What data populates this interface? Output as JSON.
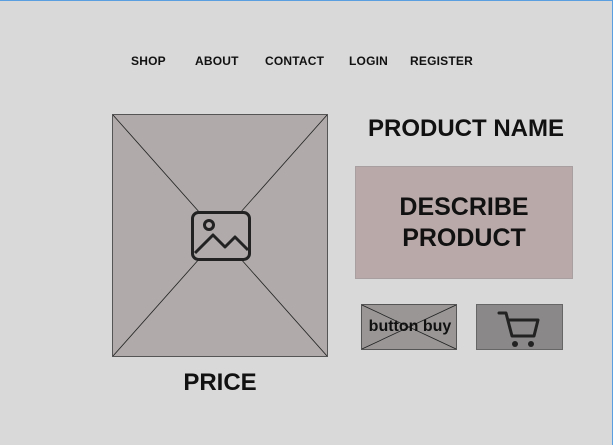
{
  "nav": {
    "items": [
      {
        "label": "SHOP"
      },
      {
        "label": "ABOUT"
      },
      {
        "label": "CONTACT"
      },
      {
        "label": "LOGIN"
      },
      {
        "label": "REGISTER"
      }
    ]
  },
  "product": {
    "image_icon": "image-placeholder-icon",
    "price_label": "PRICE",
    "name_label": "PRODUCT NAME",
    "description": "DESCRIBE\nPRODUCT",
    "buy_label": "button buy",
    "cart_icon": "shopping-cart-icon"
  },
  "colors": {
    "background": "#d9d9d9",
    "image_placeholder": "#b0aaaa",
    "description_box": "#b9a9a9",
    "buy_button": "#9a9696",
    "cart_button": "#8a8888"
  }
}
